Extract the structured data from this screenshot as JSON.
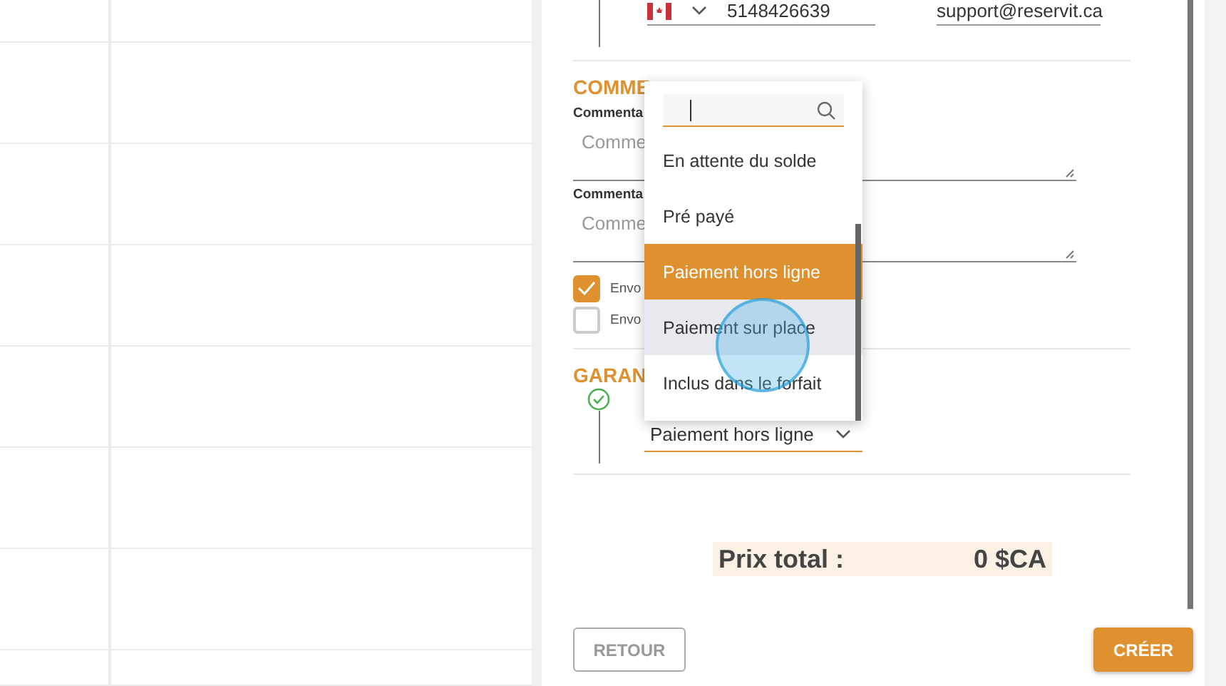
{
  "contact": {
    "phone": "5148426639",
    "email": "support@reservit.ca"
  },
  "comments": {
    "title": "COMME",
    "fields": [
      {
        "label": "Commenta",
        "placeholder": "Comme"
      },
      {
        "label": "Commenta",
        "placeholder": "Comme"
      }
    ],
    "options": [
      {
        "label": "Envo",
        "checked": true
      },
      {
        "label": "Envo",
        "checked": false
      }
    ]
  },
  "guarantee": {
    "title": "GARAN",
    "done": true,
    "value": "Paiement hors ligne"
  },
  "dropdown": {
    "items": [
      {
        "label": "En attente du solde",
        "selected": false,
        "hovered": false
      },
      {
        "label": "Pré payé",
        "selected": false,
        "hovered": false
      },
      {
        "label": "Paiement hors ligne",
        "selected": true,
        "hovered": false
      },
      {
        "label": "Paiement sur place",
        "selected": false,
        "hovered": true
      },
      {
        "label": "Inclus dans le forfait",
        "selected": false,
        "hovered": false
      }
    ]
  },
  "total": {
    "label": "Prix total :",
    "value": "0 $CA"
  },
  "buttons": {
    "back": "RETOUR",
    "create": "CRÉER"
  }
}
